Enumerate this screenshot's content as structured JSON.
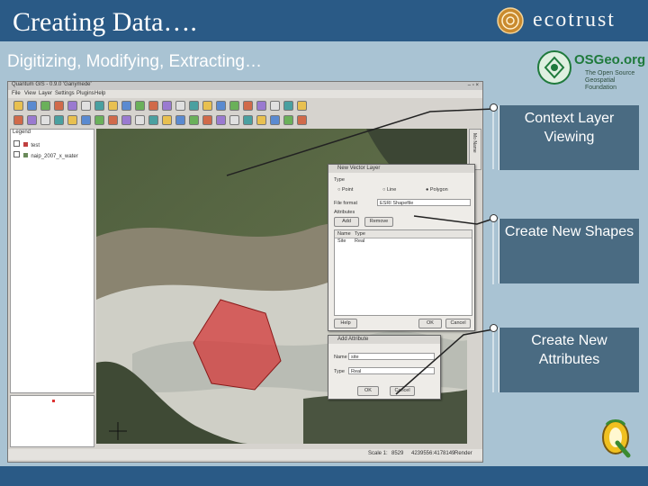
{
  "slide": {
    "title": "Creating Data….",
    "subtitle": "Digitizing, Modifying, Extracting…",
    "ecotrust_logo_text": "ecotrust",
    "osgeo_logo_text": "OSGeo.org",
    "osgeo_tagline_1": "The Open Source",
    "osgeo_tagline_2": "Geospatial Foundation",
    "colors": {
      "title_bar": "#2a5a86",
      "background": "#a9c3d3",
      "callout": "#4a6b82"
    }
  },
  "callouts": [
    {
      "text": "Context Layer Viewing"
    },
    {
      "text": "Create New Shapes"
    },
    {
      "text": "Create New Attributes"
    }
  ],
  "qgis": {
    "window_title": "Quantum GIS - 0.9.0 'Ganymede'",
    "menu": [
      "File",
      "View",
      "Layer",
      "Settings",
      "Plugins",
      "Help"
    ],
    "legend_title": "Legend",
    "legend_layers": [
      "test",
      "naip_2007_x_water"
    ],
    "right_tab": "Mo Name",
    "status": {
      "scale_label": "Scale 1:",
      "scale_value": "8529",
      "coords": "4239556:4178149",
      "render_label": "Render"
    },
    "new_vector_layer": {
      "title": "New Vector Layer",
      "type_label": "Type",
      "types": [
        "Point",
        "Line",
        "Polygon"
      ],
      "selected_type": "Polygon",
      "file_format_label": "File format",
      "file_format_value": "ESRI Shapefile",
      "attributes_label": "Attributes",
      "add_button": "Add",
      "remove_button": "Remove",
      "table_headers": [
        "Name",
        "Type"
      ],
      "table_rows": [
        [
          "Site",
          "Real"
        ]
      ],
      "help_button": "Help",
      "ok_button": "OK",
      "cancel_button": "Cancel"
    },
    "add_attribute": {
      "title": "Add Attribute",
      "name_label": "Name",
      "name_value": "site",
      "type_label": "Type",
      "type_value": "Real",
      "ok_button": "OK",
      "cancel_button": "Cancel"
    }
  }
}
